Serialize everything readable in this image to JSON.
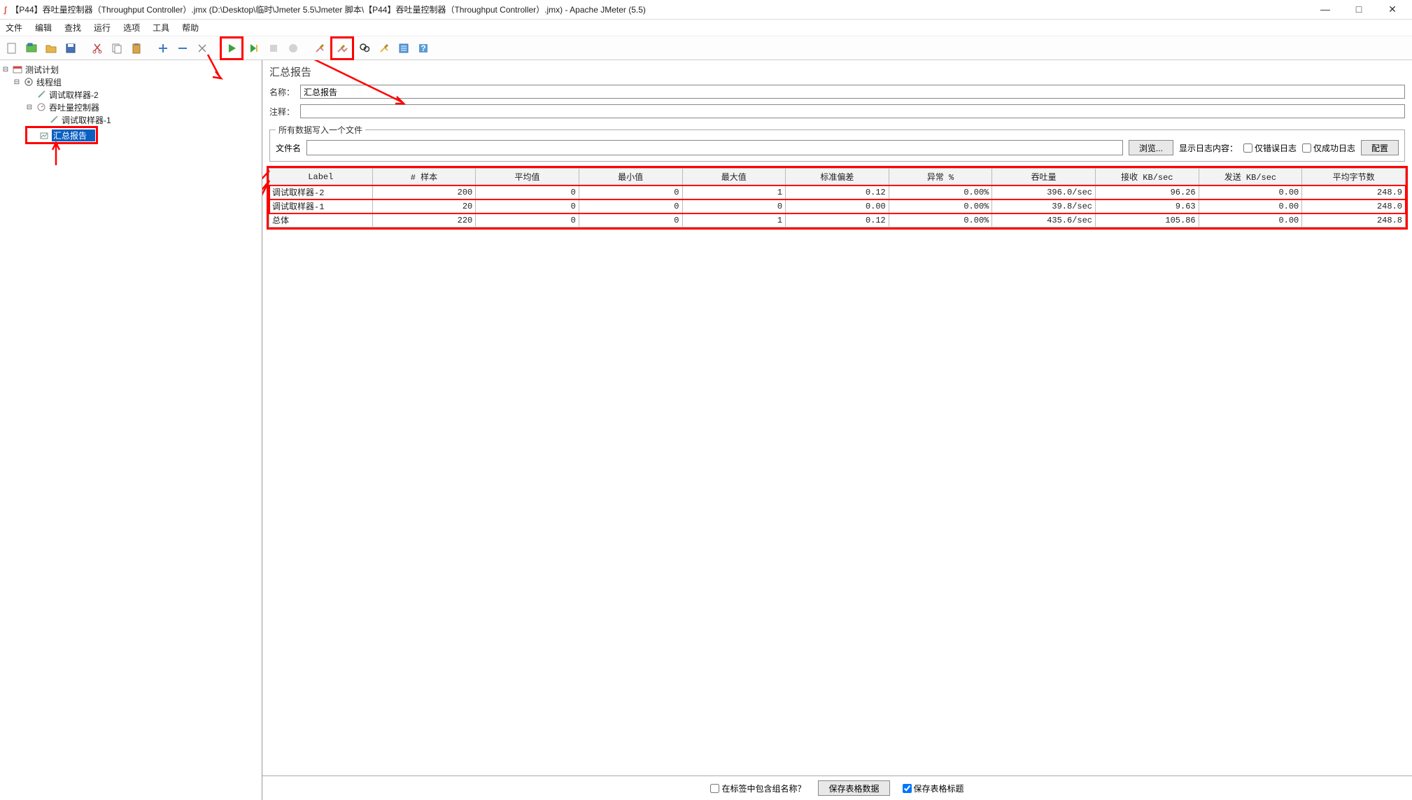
{
  "window": {
    "title": "【P44】吞吐量控制器（Throughput Controller）.jmx (D:\\Desktop\\临时\\Jmeter 5.5\\Jmeter 脚本\\【P44】吞吐量控制器（Throughput Controller）.jmx) - Apache JMeter (5.5)"
  },
  "menu": {
    "file": "文件",
    "edit": "编辑",
    "search": "查找",
    "run": "运行",
    "options": "选项",
    "tools": "工具",
    "help": "帮助"
  },
  "tree": {
    "root": "测试计划",
    "thread_group": "线程组",
    "sampler2": "调试取样器-2",
    "throughput": "吞吐量控制器",
    "sampler1": "调试取样器-1",
    "summary": "汇总报告"
  },
  "panel": {
    "heading": "汇总报告",
    "name_label": "名称：",
    "name_value": "汇总报告",
    "comment_label": "注释：",
    "comment_value": "",
    "fieldset_legend": "所有数据写入一个文件",
    "filename_label": "文件名",
    "filename_value": "",
    "browse_button": "浏览...",
    "show_log_label": "显示日志内容：",
    "errors_only": "仅错误日志",
    "success_only": "仅成功日志",
    "configure_button": "配置"
  },
  "table": {
    "headers": [
      "Label",
      "# 样本",
      "平均值",
      "最小值",
      "最大值",
      "标准偏差",
      "异常 %",
      "吞吐量",
      "接收 KB/sec",
      "发送 KB/sec",
      "平均字节数"
    ],
    "rows": [
      {
        "label": "调试取样器-2",
        "samples": "200",
        "avg": "0",
        "min": "0",
        "max": "1",
        "stddev": "0.12",
        "error": "0.00%",
        "throughput": "396.0/sec",
        "recv": "96.26",
        "sent": "0.00",
        "bytes": "248.9",
        "hl": true
      },
      {
        "label": "调试取样器-1",
        "samples": "20",
        "avg": "0",
        "min": "0",
        "max": "0",
        "stddev": "0.00",
        "error": "0.00%",
        "throughput": "39.8/sec",
        "recv": "9.63",
        "sent": "0.00",
        "bytes": "248.0",
        "hl": true
      },
      {
        "label": "总体",
        "samples": "220",
        "avg": "0",
        "min": "0",
        "max": "1",
        "stddev": "0.12",
        "error": "0.00%",
        "throughput": "435.6/sec",
        "recv": "105.86",
        "sent": "0.00",
        "bytes": "248.8",
        "hl": false
      }
    ]
  },
  "bottom": {
    "include_group": "在标签中包含组名称？",
    "save_table": "保存表格数据",
    "save_header": "保存表格标题"
  }
}
